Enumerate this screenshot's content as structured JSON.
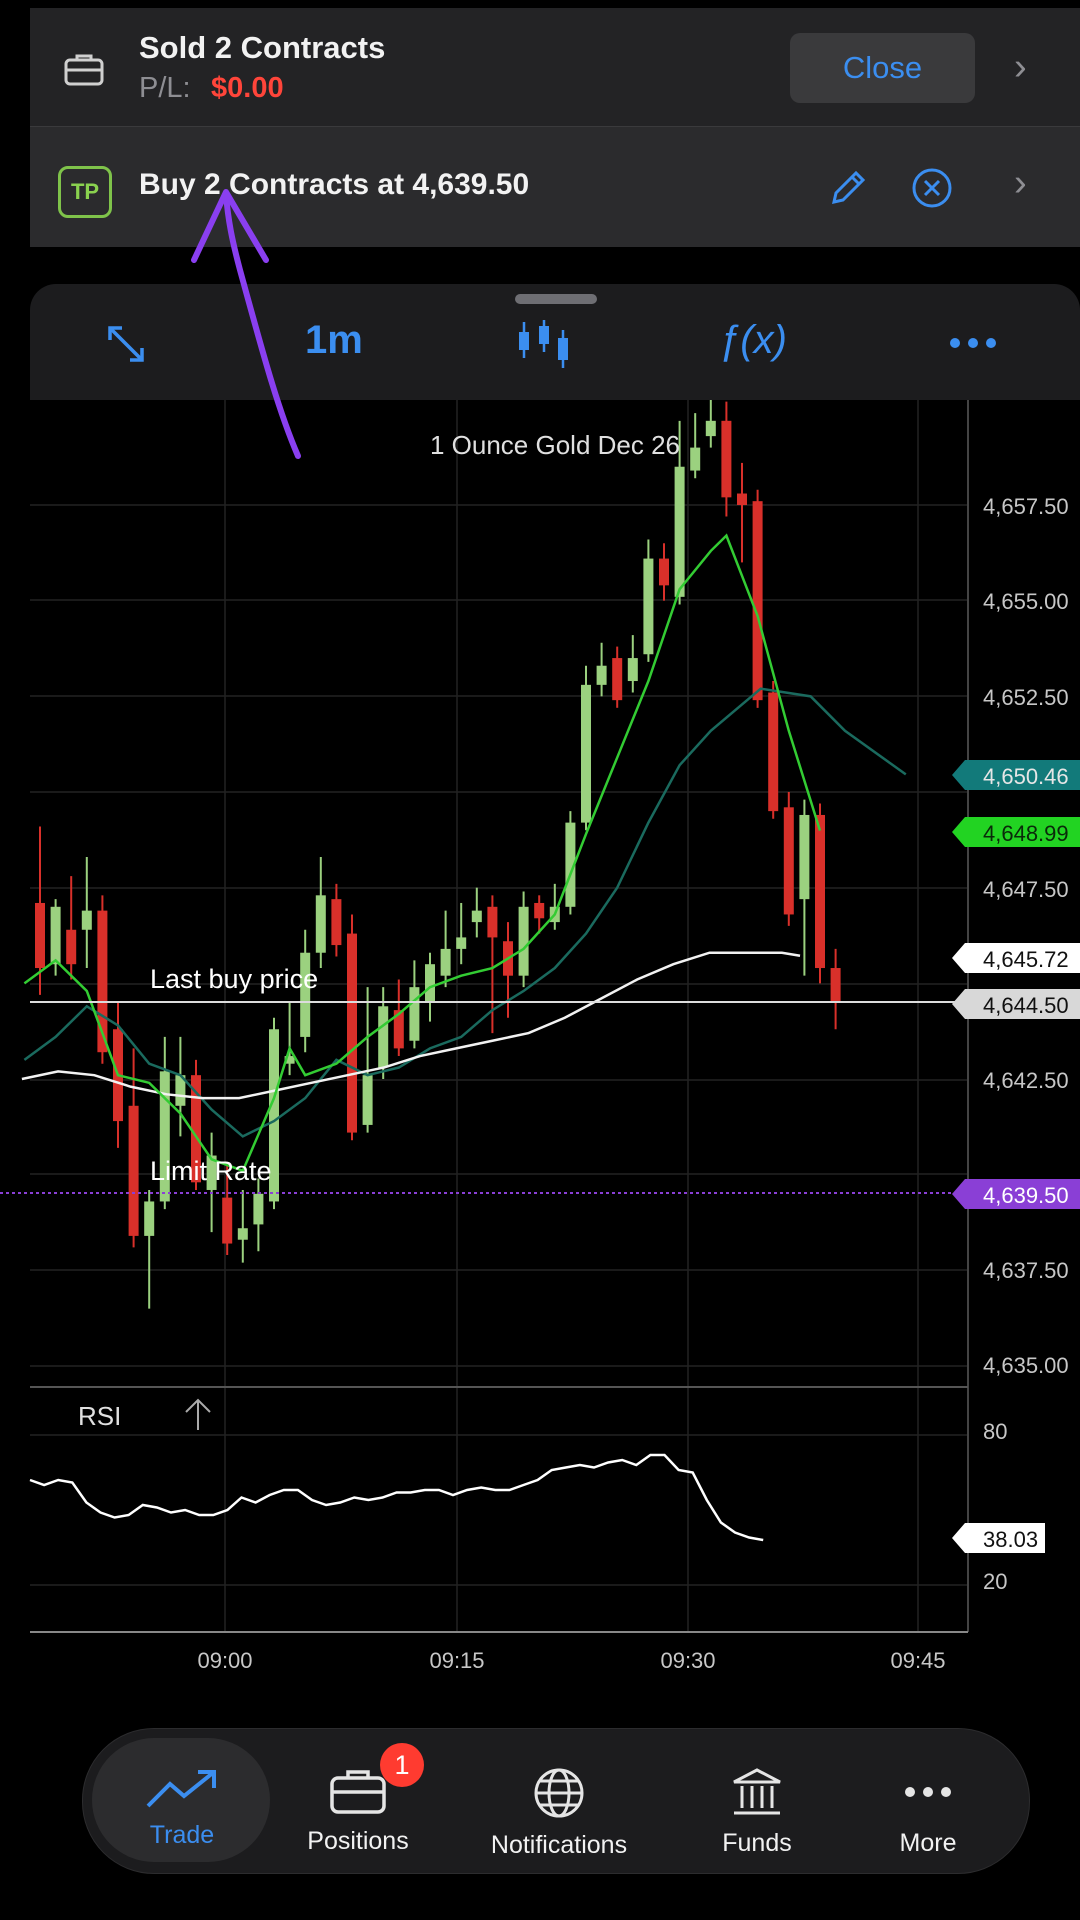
{
  "position": {
    "title": "Sold 2 Contracts",
    "pl_label": "P/L:",
    "pl_value": "$0.00",
    "close_label": "Close"
  },
  "order": {
    "badge": "TP",
    "text": "Buy 2 Contracts at 4,639.50"
  },
  "toolbar": {
    "timeframe": "1m",
    "fx_label": "ƒ(x)"
  },
  "chart": {
    "title": "1 Ounce Gold Dec 26",
    "last_buy_label": "Last buy price",
    "limit_label": "Limit Rate",
    "rsi_label": "RSI",
    "price_ticks": [
      "4,657.50",
      "4,655.00",
      "4,652.50",
      "4,647.50",
      "4,642.50",
      "4,637.50",
      "4,635.00"
    ],
    "time_ticks": [
      "09:00",
      "09:15",
      "09:30",
      "09:45"
    ],
    "rsi_ticks": [
      "80",
      "20"
    ],
    "markers": {
      "teal": "4,650.46",
      "green": "4,648.99",
      "white": "4,645.72",
      "last_buy": "4,644.50",
      "limit": "4,639.50",
      "rsi": "38.03"
    }
  },
  "nav": {
    "items": [
      {
        "label": "Trade",
        "icon": "trend-icon"
      },
      {
        "label": "Positions",
        "icon": "briefcase-icon"
      },
      {
        "label": "Notifications",
        "icon": "globe-icon"
      },
      {
        "label": "Funds",
        "icon": "bank-icon"
      },
      {
        "label": "More",
        "icon": "more-icon"
      }
    ],
    "positions_badge": "1"
  },
  "colors": {
    "accent": "#3b8ef0",
    "bull": "#9bd17f",
    "bear": "#d9302a",
    "limit": "#8a3fd6",
    "teal_marker": "#127a7a",
    "green_marker": "#22d322"
  }
}
